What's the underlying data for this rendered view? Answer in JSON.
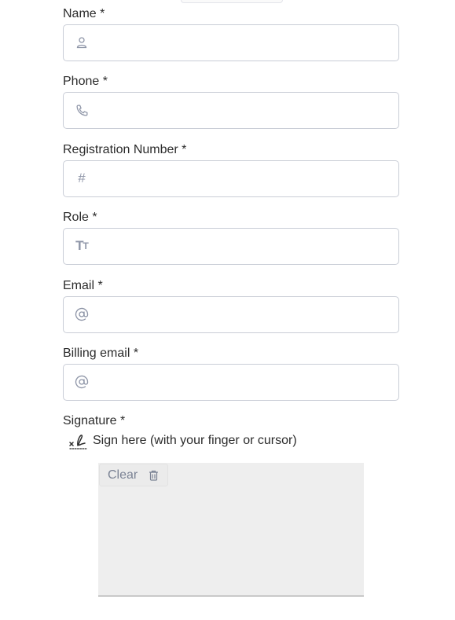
{
  "form": {
    "fields": [
      {
        "label": "Name *",
        "icon": "person-icon",
        "value": ""
      },
      {
        "label": "Phone *",
        "icon": "phone-icon",
        "value": ""
      },
      {
        "label": "Registration Number *",
        "icon": "hash-icon",
        "value": ""
      },
      {
        "label": "Role *",
        "icon": "text-type-icon",
        "value": ""
      },
      {
        "label": "Email *",
        "icon": "at-icon",
        "value": ""
      },
      {
        "label": "Billing email *",
        "icon": "at-icon",
        "value": ""
      }
    ],
    "signature": {
      "label": "Signature *",
      "hint": "Sign here (with your finger or cursor)",
      "clear_label": "Clear"
    }
  },
  "icons": {
    "hash_glyph": "#",
    "tt_glyph_big": "T",
    "tt_glyph_small": "T"
  },
  "colors": {
    "icon": "#8f96a8",
    "border": "#c9cdd6",
    "pad_background": "#eeeeee"
  }
}
